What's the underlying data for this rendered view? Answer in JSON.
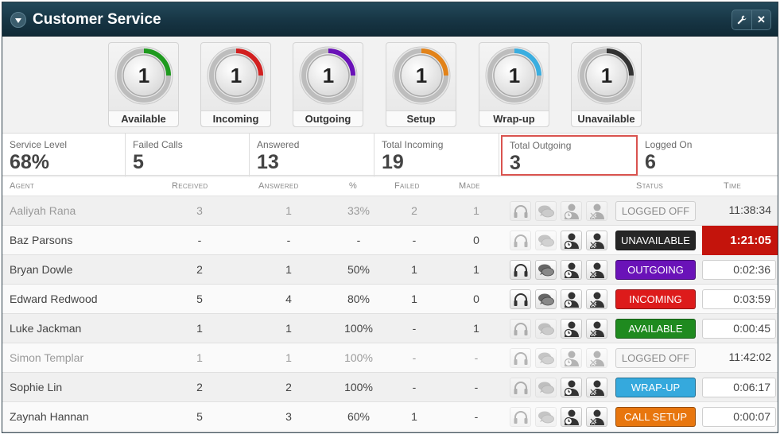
{
  "window": {
    "title": "Customer Service"
  },
  "gauges": [
    {
      "count": "1",
      "label": "Available",
      "color": "#1e9a1e"
    },
    {
      "count": "1",
      "label": "Incoming",
      "color": "#d22020"
    },
    {
      "count": "1",
      "label": "Outgoing",
      "color": "#6a12b8"
    },
    {
      "count": "1",
      "label": "Setup",
      "color": "#e2831a"
    },
    {
      "count": "1",
      "label": "Wrap-up",
      "color": "#3aaee0"
    },
    {
      "count": "1",
      "label": "Unavailable",
      "color": "#333333"
    }
  ],
  "stats": [
    {
      "label": "Service Level",
      "value": "68%"
    },
    {
      "label": "Failed Calls",
      "value": "5"
    },
    {
      "label": "Answered",
      "value": "13"
    },
    {
      "label": "Total Incoming",
      "value": "19"
    },
    {
      "label": "Total Outgoing",
      "value": "3"
    },
    {
      "label": "Logged On",
      "value": "6"
    }
  ],
  "columns": {
    "agent": "Agent",
    "received": "Received",
    "answered": "Answered",
    "percent": "%",
    "failed": "Failed",
    "made": "Made",
    "status": "Status",
    "time": "Time"
  },
  "status_colors": {
    "LOGGED OFF": "#f4f4f4",
    "UNAVAILABLE": "#262626",
    "OUTGOING": "#6a12b8",
    "INCOMING": "#dd1b1b",
    "AVAILABLE": "#1f8a1f",
    "WRAP-UP": "#35a9dd",
    "CALL SETUP": "#e8760e"
  },
  "agents": [
    {
      "name": "Aaliyah Rana",
      "received": "3",
      "answered": "1",
      "percent": "33%",
      "failed": "2",
      "made": "1",
      "status": "LOGGED OFF",
      "time": "11:38:34",
      "off": true,
      "icons": [
        0,
        0,
        0,
        0
      ]
    },
    {
      "name": "Baz Parsons",
      "received": "-",
      "answered": "-",
      "percent": "-",
      "failed": "-",
      "made": "0",
      "status": "UNAVAILABLE",
      "time": "1:21:05",
      "alert": true,
      "icons": [
        0,
        0,
        1,
        1
      ]
    },
    {
      "name": "Bryan Dowle",
      "received": "2",
      "answered": "1",
      "percent": "50%",
      "failed": "1",
      "made": "1",
      "status": "OUTGOING",
      "time": "0:02:36",
      "icons": [
        1,
        1,
        1,
        1
      ]
    },
    {
      "name": "Edward Redwood",
      "received": "5",
      "answered": "4",
      "percent": "80%",
      "failed": "1",
      "made": "0",
      "status": "INCOMING",
      "time": "0:03:59",
      "icons": [
        1,
        1,
        1,
        1
      ]
    },
    {
      "name": "Luke Jackman",
      "received": "1",
      "answered": "1",
      "percent": "100%",
      "failed": "-",
      "made": "1",
      "status": "AVAILABLE",
      "time": "0:00:45",
      "icons": [
        0,
        0,
        1,
        1
      ]
    },
    {
      "name": "Simon Templar",
      "received": "1",
      "answered": "1",
      "percent": "100%",
      "failed": "-",
      "made": "-",
      "status": "LOGGED OFF",
      "time": "11:42:02",
      "off": true,
      "icons": [
        0,
        0,
        0,
        0
      ]
    },
    {
      "name": "Sophie Lin",
      "received": "2",
      "answered": "2",
      "percent": "100%",
      "failed": "-",
      "made": "-",
      "status": "WRAP-UP",
      "time": "0:06:17",
      "icons": [
        0,
        0,
        1,
        1
      ]
    },
    {
      "name": "Zaynah Hannan",
      "received": "5",
      "answered": "3",
      "percent": "60%",
      "failed": "1",
      "made": "-",
      "status": "CALL SETUP",
      "time": "0:00:07",
      "icons": [
        0,
        0,
        1,
        1
      ]
    }
  ]
}
